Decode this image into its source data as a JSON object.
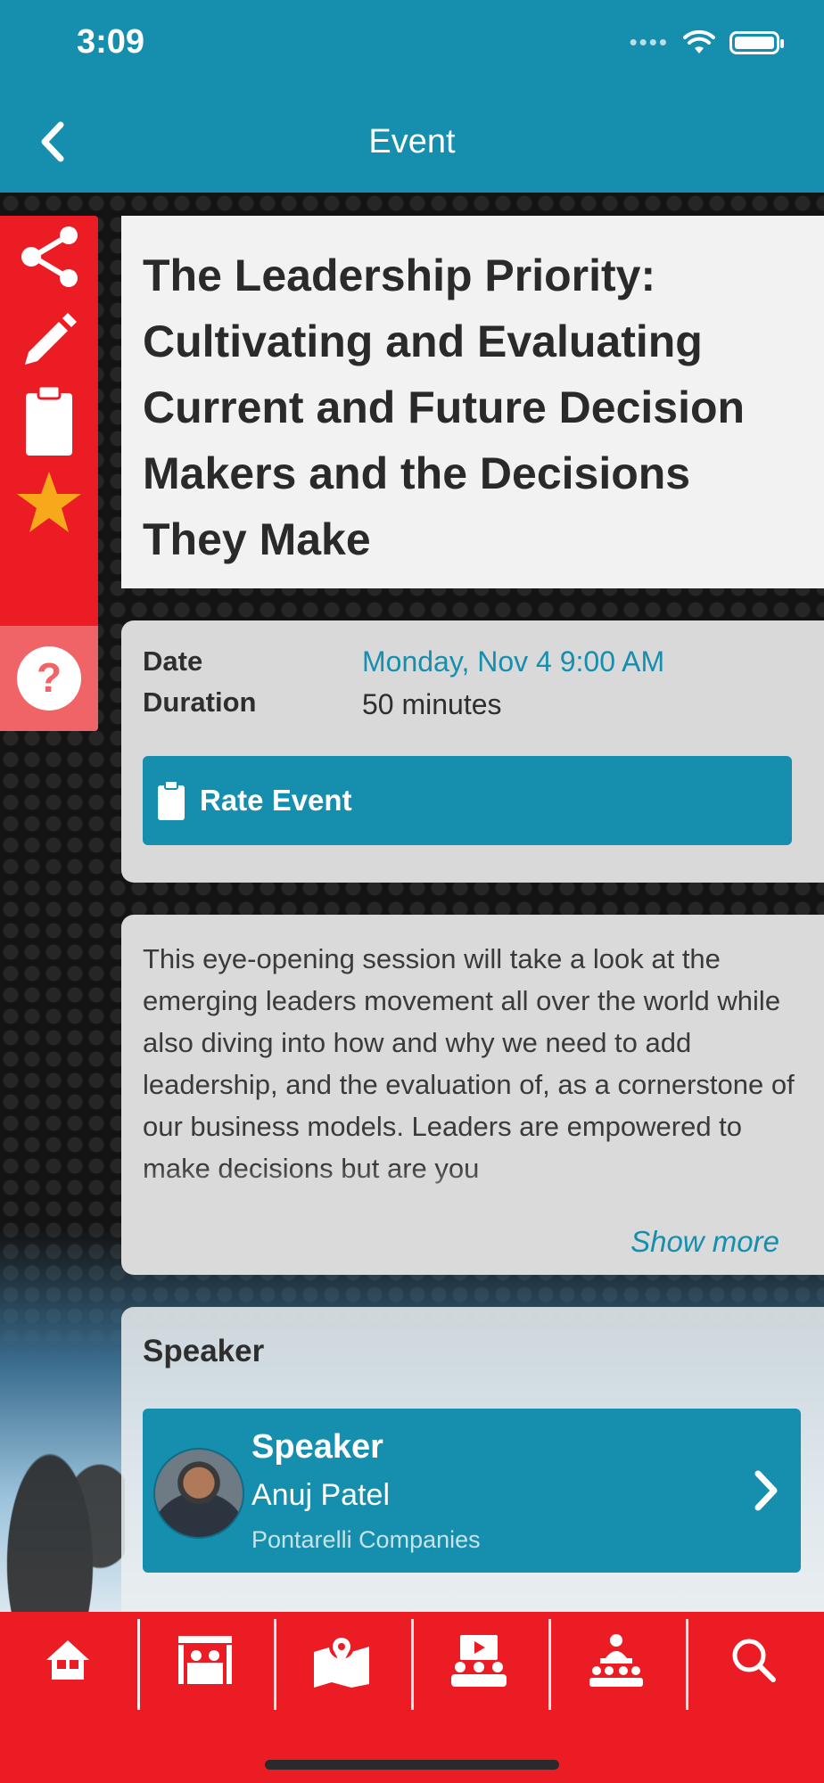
{
  "status_bar": {
    "time": "3:09"
  },
  "header": {
    "title": "Event"
  },
  "event": {
    "title": "The Leadership Priority: Cultivating and Evaluating Current and Future Decision Makers and the Decisions They Make",
    "date_label": "Date",
    "date_value": "Monday, Nov 4 9:00 AM",
    "duration_label": "Duration",
    "duration_value": "50 minutes",
    "rate_button": "Rate Event",
    "description": "This eye-opening session will take a look at the emerging leaders movement all over the world while also diving into how and why we need to add leadership, and the evaluation of, as a cornerstone of our business models. Leaders are empowered to make decisions but are you",
    "show_more": "Show more"
  },
  "speaker_section": {
    "heading": "Speaker",
    "role": "Speaker",
    "name": "Anuj Patel",
    "company": "Pontarelli Companies"
  },
  "side_actions": [
    "share-icon",
    "pencil-icon",
    "clipboard-icon",
    "star-icon",
    "help-icon"
  ],
  "tabs": [
    "home-icon",
    "exhibitor-booth-icon",
    "map-icon",
    "video-presentation-icon",
    "speaker-podium-icon",
    "search-icon"
  ],
  "colors": {
    "primary": "#168fae",
    "accent": "#ec1c24",
    "star": "#f7a81b",
    "text": "#2a2a2a"
  }
}
